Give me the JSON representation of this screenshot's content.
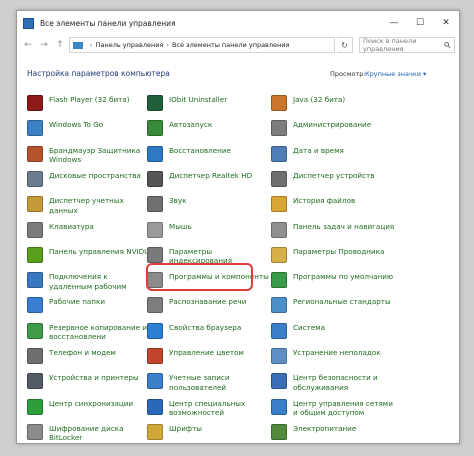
{
  "window": {
    "title": "Все элементы панели управления",
    "controls": {
      "minimize": "—",
      "maximize": "☐",
      "close": "✕"
    }
  },
  "addressbar": {
    "back": "←",
    "forward": "→",
    "up": "↑",
    "path": [
      "Панель управления",
      "Все элементы панели управления"
    ],
    "separator": "›",
    "refresh": "↻",
    "search_placeholder": "Поиск в панели управления",
    "search_icon": "search-icon"
  },
  "header": {
    "title": "Настройка параметров компьютера",
    "view_label": "Просмотр:",
    "view_value": "Крупные значки ▾"
  },
  "items": [
    [
      {
        "label": "Flash Player (32 бита)",
        "icon": "flash-icon",
        "color": "#8b1a1a"
      },
      {
        "label": "Windows To Go",
        "icon": "usb-drive-icon",
        "color": "#3f7fc4"
      },
      {
        "label": "Брандмауэр Защитника Windows",
        "icon": "firewall-icon",
        "color": "#b5542c"
      },
      {
        "label": "Дисковые пространства",
        "icon": "storage-spaces-icon",
        "color": "#6b7d8c"
      },
      {
        "label": "Диспетчер учетных данных",
        "icon": "credential-manager-icon",
        "color": "#c49a3c"
      },
      {
        "label": "Клавиатура",
        "icon": "keyboard-icon",
        "color": "#7b7b7b"
      },
      {
        "label": "Панель управления NVIDIA",
        "icon": "nvidia-icon",
        "color": "#5a9e1e"
      },
      {
        "label": "Подключения к удаленным рабочим",
        "icon": "remote-desktop-icon",
        "color": "#3b78c2"
      },
      {
        "label": "Рабочие папки",
        "icon": "work-folders-icon",
        "color": "#3a7ecf"
      },
      {
        "label": "Резервное копирование и восстановлени",
        "icon": "backup-icon",
        "color": "#3f9a4a"
      },
      {
        "label": "Телефон и модем",
        "icon": "phone-modem-icon",
        "color": "#6e6e6e"
      },
      {
        "label": "Устройства и принтеры",
        "icon": "printer-icon",
        "color": "#555b66"
      },
      {
        "label": "Центр синхронизации",
        "icon": "sync-center-icon",
        "color": "#2e9e3c"
      },
      {
        "label": "Шифрование диска BitLocker",
        "icon": "bitlocker-icon",
        "color": "#8a8a8a"
      }
    ],
    [
      {
        "label": "IObit Uninstaller",
        "icon": "iobit-icon",
        "color": "#1f5f3a"
      },
      {
        "label": "Автозапуск",
        "icon": "autoplay-icon",
        "color": "#3b8a3b"
      },
      {
        "label": "Восстановление",
        "icon": "recovery-icon",
        "color": "#2f79c2"
      },
      {
        "label": "Диспетчер Realtek HD",
        "icon": "speaker-icon",
        "color": "#555555"
      },
      {
        "label": "Звук",
        "icon": "sound-icon",
        "color": "#707070"
      },
      {
        "label": "Мышь",
        "icon": "mouse-icon",
        "color": "#9a9a9a"
      },
      {
        "label": "Параметры индексирования",
        "icon": "indexing-icon",
        "color": "#7a7a7a"
      },
      {
        "label": "Программы и компоненты",
        "icon": "programs-icon",
        "color": "#8a8a8a"
      },
      {
        "label": "Распознавание речи",
        "icon": "microphone-icon",
        "color": "#7d7d7d"
      },
      {
        "label": "Свойства браузера",
        "icon": "internet-options-icon",
        "color": "#2f7fd0"
      },
      {
        "label": "Управление цветом",
        "icon": "color-management-icon",
        "color": "#c2452e"
      },
      {
        "label": "Учетные записи пользователей",
        "icon": "user-accounts-icon",
        "color": "#3a7fc8"
      },
      {
        "label": "Центр специальных возможностей",
        "icon": "accessibility-icon",
        "color": "#2a68b8"
      },
      {
        "label": "Шрифты",
        "icon": "fonts-icon",
        "color": "#d2a83a"
      }
    ],
    [
      {
        "label": "Java (32 бита)",
        "icon": "java-icon",
        "color": "#c8762b"
      },
      {
        "label": "Администрирование",
        "icon": "admin-tools-icon",
        "color": "#7d7d7d"
      },
      {
        "label": "Дата и время",
        "icon": "date-time-icon",
        "color": "#4f7fb5"
      },
      {
        "label": "Диспетчер устройств",
        "icon": "device-manager-icon",
        "color": "#6f6f6f"
      },
      {
        "label": "История файлов",
        "icon": "file-history-icon",
        "color": "#d8a637"
      },
      {
        "label": "Панель задач и навигация",
        "icon": "taskbar-icon",
        "color": "#8f8f8f"
      },
      {
        "label": "Параметры Проводника",
        "icon": "explorer-options-icon",
        "color": "#d8b04a"
      },
      {
        "label": "Программы по умолчанию",
        "icon": "default-programs-icon",
        "color": "#3a9a4a"
      },
      {
        "label": "Региональные стандарты",
        "icon": "region-icon",
        "color": "#4f8fc9"
      },
      {
        "label": "Система",
        "icon": "system-icon",
        "color": "#3a7fc8"
      },
      {
        "label": "Устранение неполадок",
        "icon": "troubleshooting-icon",
        "color": "#5d8fc4"
      },
      {
        "label": "Центр безопасности и обслуживания",
        "icon": "security-flag-icon",
        "color": "#3b6fb5"
      },
      {
        "label": "Центр управления сетями и общим доступом",
        "icon": "network-center-icon",
        "color": "#3a7fc8"
      },
      {
        "label": "Электропитание",
        "icon": "power-options-icon",
        "color": "#4f8a3c"
      }
    ]
  ]
}
